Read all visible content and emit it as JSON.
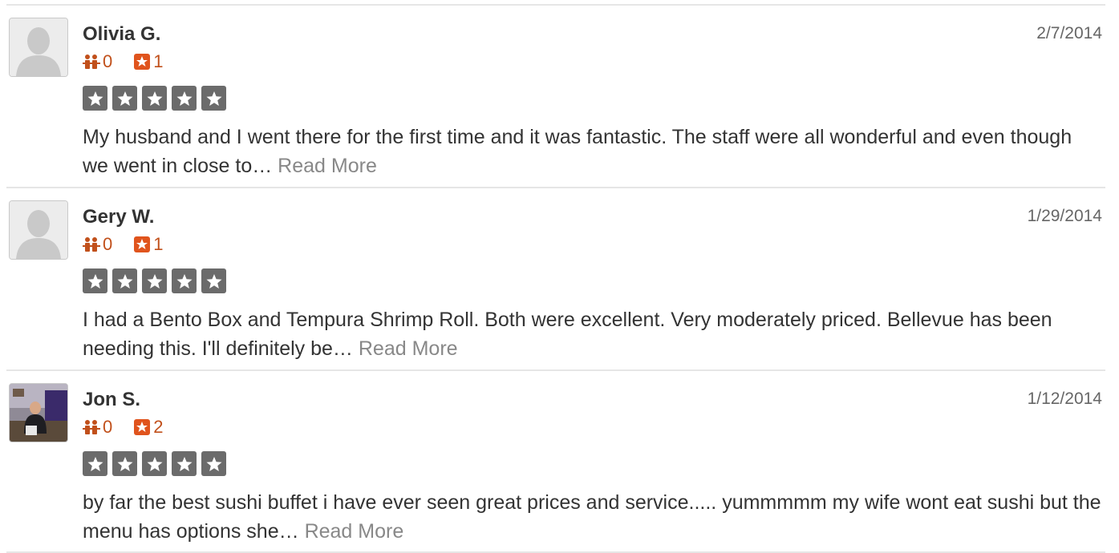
{
  "reviews": [
    {
      "name": "Olivia G.",
      "date": "2/7/2014",
      "friends": "0",
      "review_count": "1",
      "rating": 5,
      "text": "My husband and I went there for the first time and it was fantastic.  The staff were all wonderful and even though we went in close to…",
      "read_more": "Read More",
      "avatar": "default-avatar"
    },
    {
      "name": "Gery W.",
      "date": "1/29/2014",
      "friends": "0",
      "review_count": "1",
      "rating": 5,
      "text": "I had a Bento Box and Tempura Shrimp Roll. Both were excellent. Very moderately priced. Bellevue has been needing this. I'll definitely be…",
      "read_more": "Read More",
      "avatar": "default-avatar"
    },
    {
      "name": "Jon S.",
      "date": "1/12/2014",
      "friends": "0",
      "review_count": "2",
      "rating": 5,
      "text": "by far the best sushi buffet i have ever seen great prices and service..... yummmmm my wife wont eat sushi but the menu has options she…",
      "read_more": "Read More",
      "avatar": "user-photo"
    }
  ],
  "colors": {
    "accent": "#c1501b",
    "star_box": "#6b6b6b",
    "divider": "#e6e6e6",
    "read_more": "#888888"
  }
}
